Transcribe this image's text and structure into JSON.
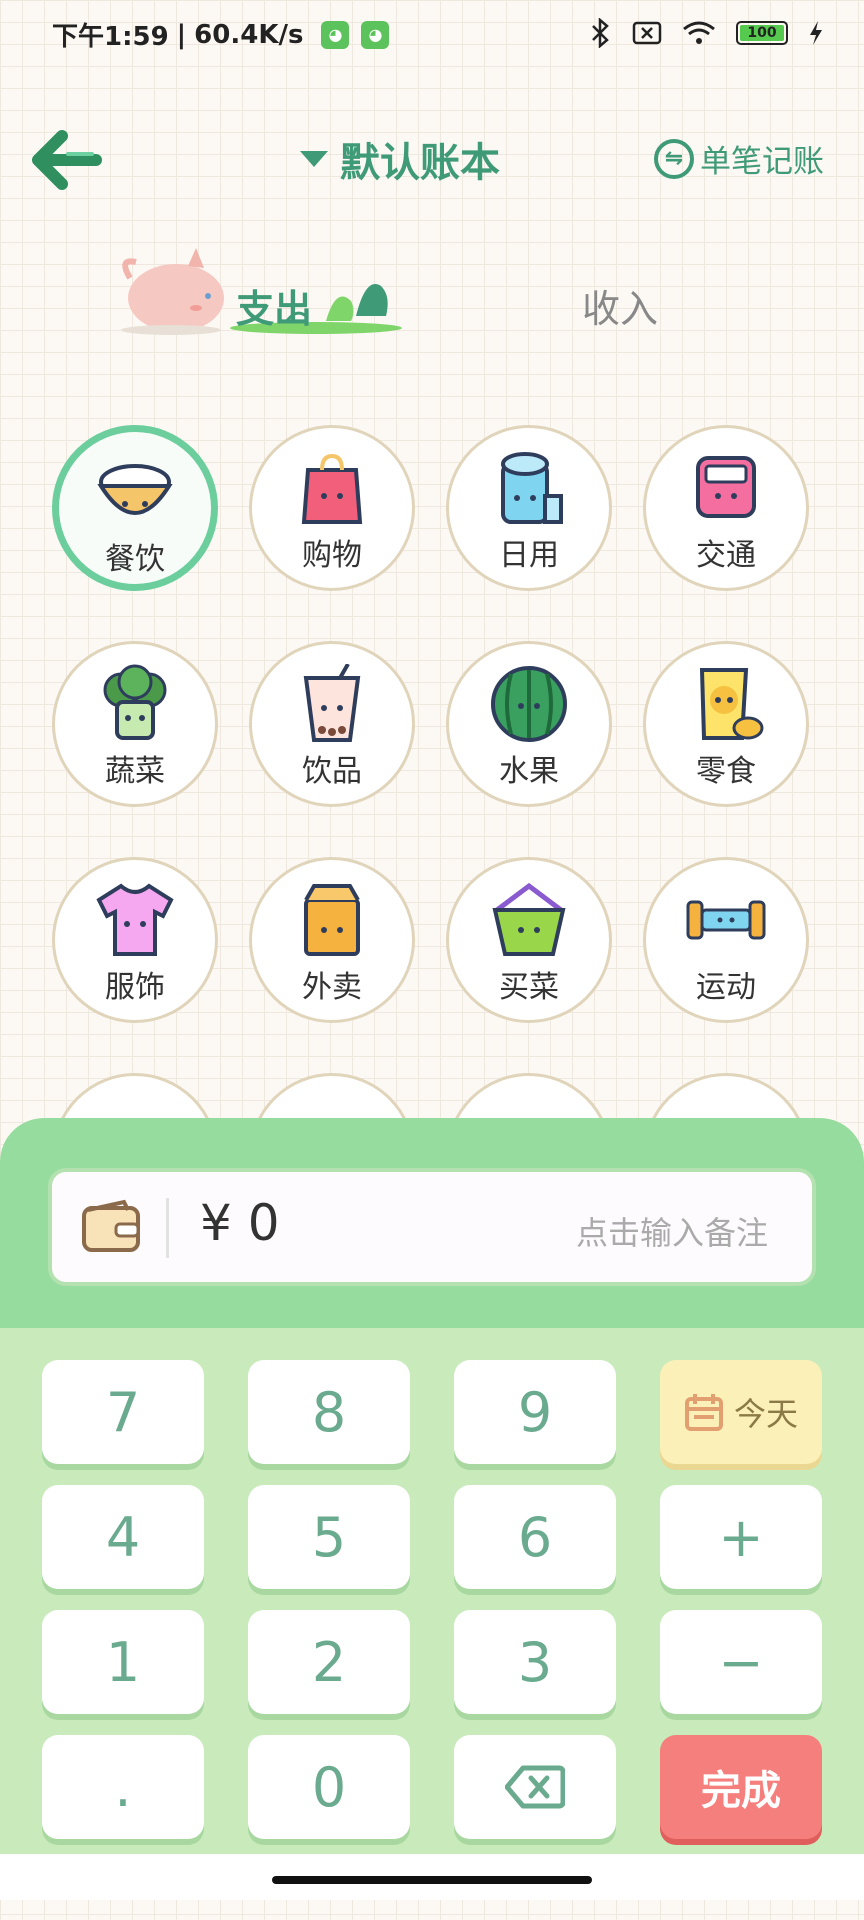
{
  "status_bar": {
    "time": "下午1:59",
    "speed": "60.4K/s",
    "battery": "100"
  },
  "header": {
    "title": "默认账本",
    "single_entry": "单笔记账"
  },
  "tabs": {
    "expense": "支出",
    "income": "收入"
  },
  "categories": [
    {
      "label": "餐饮",
      "icon": "rice-bowl-icon",
      "selected": true
    },
    {
      "label": "购物",
      "icon": "shopping-bag-icon"
    },
    {
      "label": "日用",
      "icon": "toilet-paper-icon"
    },
    {
      "label": "交通",
      "icon": "bus-icon"
    },
    {
      "label": "蔬菜",
      "icon": "broccoli-icon"
    },
    {
      "label": "饮品",
      "icon": "bubble-tea-icon"
    },
    {
      "label": "水果",
      "icon": "watermelon-icon"
    },
    {
      "label": "零食",
      "icon": "snack-bag-icon"
    },
    {
      "label": "服饰",
      "icon": "tshirt-icon"
    },
    {
      "label": "外卖",
      "icon": "takeout-box-icon"
    },
    {
      "label": "买菜",
      "icon": "basket-icon"
    },
    {
      "label": "运动",
      "icon": "dumbbell-icon"
    }
  ],
  "entry": {
    "amount": "¥ 0",
    "note_placeholder": "点击输入备注"
  },
  "keypad": {
    "k7": "7",
    "k8": "8",
    "k9": "9",
    "today": "今天",
    "k4": "4",
    "k5": "5",
    "k6": "6",
    "plus": "+",
    "k1": "1",
    "k2": "2",
    "k3": "3",
    "minus": "−",
    "dot": ".",
    "k0": "0",
    "done": "完成"
  },
  "colors": {
    "accent": "#3f9a78",
    "panel": "#96dc9e",
    "done": "#f57f7c"
  }
}
